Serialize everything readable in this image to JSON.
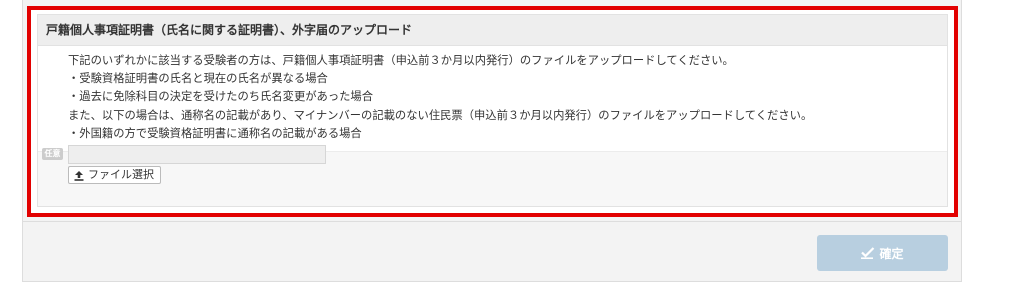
{
  "section": {
    "title": "戸籍個人事項証明書（氏名に関する証明書）、外字届のアップロード",
    "description_lines": [
      "下記のいずれかに該当する受験者の方は、戸籍個人事項証明書（申込前３か月以内発行）のファイルをアップロードしてください。",
      "・受験資格証明書の氏名と現在の氏名が異なる場合",
      "・過去に免除科目の決定を受けたのち氏名変更があった場合",
      "また、以下の場合は、通称名の記載があり、マイナンバーの記載のない住民票（申込前３か月以内発行）のファイルをアップロードしてください。",
      "・外国籍の方で受験資格証明書に通称名の記載がある場合"
    ]
  },
  "upload": {
    "badge": "任意",
    "file_value": "",
    "select_button_label": "ファイル選択",
    "icon": "upload-icon"
  },
  "footer": {
    "confirm_label": "確定",
    "icon": "check-icon"
  },
  "colors": {
    "highlight_border": "#e20000",
    "confirm_disabled_bg": "#b8cfe0",
    "badge_bg": "#cccccc"
  }
}
